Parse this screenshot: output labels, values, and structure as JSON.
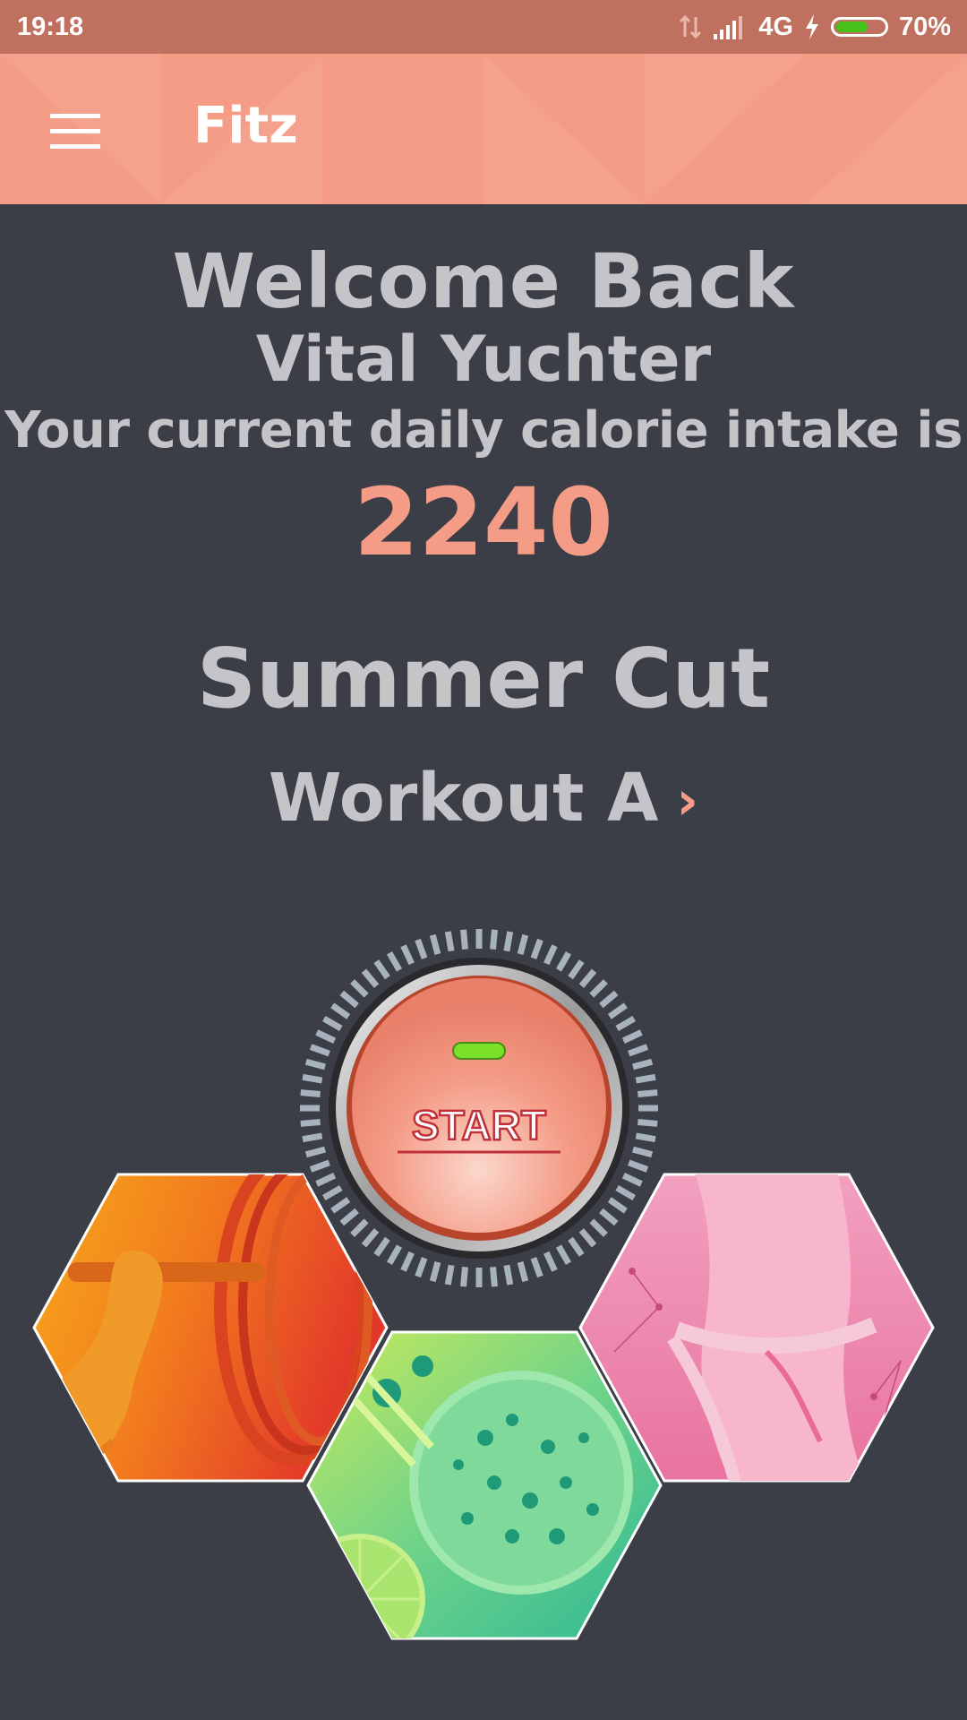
{
  "status_bar": {
    "time": "19:18",
    "network": "4G",
    "battery_percent": "70%",
    "battery_level": 0.7
  },
  "app_bar": {
    "title": "Fitz",
    "menu_icon": "hamburger-menu-icon"
  },
  "greeting": {
    "welcome": "Welcome Back",
    "user_name": "Vital Yuchter",
    "calorie_label": "Your current daily calorie intake is",
    "calorie_value": "2240"
  },
  "plan": {
    "name": "Summer Cut",
    "workout_label": "Workout A",
    "workout_chevron": "›"
  },
  "start_button": {
    "label": "START"
  },
  "tiles": [
    {
      "name": "weightlifting",
      "icon": "barbell-lift-image"
    },
    {
      "name": "nutrition",
      "icon": "healthy-food-image"
    },
    {
      "name": "body-measurement",
      "icon": "waist-measuring-tape-image"
    }
  ],
  "colors": {
    "accent": "#f49c86",
    "background": "#3b3d47",
    "text": "#c4c4c9",
    "status_bar": "#c0705f",
    "start_led": "#7be02a"
  }
}
